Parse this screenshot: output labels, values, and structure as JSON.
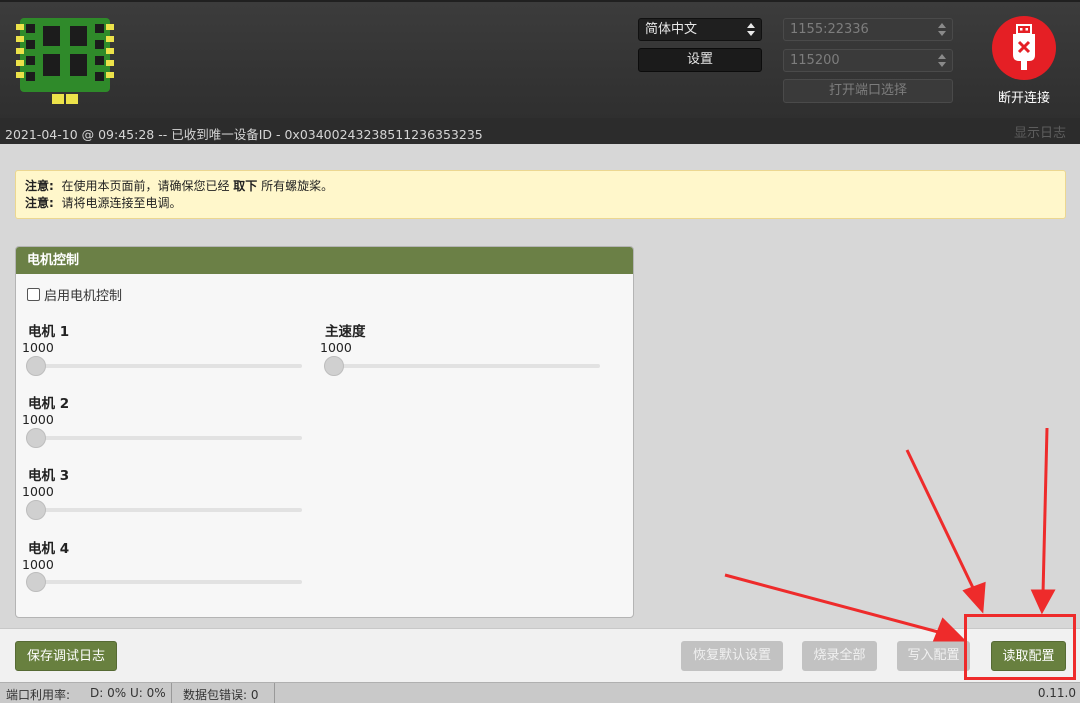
{
  "header": {
    "language_select": "简体中文",
    "settings_button": "设置",
    "port_select": "1155:22336",
    "baud_select": "115200",
    "open_port_button": "打开端口选择",
    "connect_label": "断开连接"
  },
  "logbar": {
    "message": "2021-04-10 @ 09:45:28 -- 已收到唯一设备ID - 0x0340024323851123635323​5",
    "show_log": "显示日志"
  },
  "notes": {
    "line1": {
      "prefix": "注意:",
      "text_before": "在使用本页面前，请确保您已经",
      "emphasis": "取下",
      "text_after": "所有螺旋桨。"
    },
    "line2": {
      "prefix": "注意:",
      "text": "请将电源连接至电调。"
    }
  },
  "panel": {
    "title": "电机控制",
    "enable_label": "启用电机控制",
    "enable_checked": false,
    "motors": [
      {
        "label": "电机 1",
        "value": "1000"
      },
      {
        "label": "电机 2",
        "value": "1000"
      },
      {
        "label": "电机 3",
        "value": "1000"
      },
      {
        "label": "电机 4",
        "value": "1000"
      }
    ],
    "master": {
      "label": "主速度",
      "value": "1000"
    }
  },
  "toolbar": {
    "save_log": "保存调试日志",
    "restore_defaults": "恢复默认设置",
    "flash_all": "烧录全部",
    "write_config": "写入配置",
    "read_config": "读取配置"
  },
  "status": {
    "port_usage": "端口利用率:",
    "port_usage_value": "D: 0% U: 0%",
    "packet_errors": "数据包错误: 0",
    "version": "0.11.0"
  },
  "colors": {
    "accent_green": "#6b8046",
    "connect_red": "#e51f25",
    "annotation_red": "#ee2b2b"
  }
}
